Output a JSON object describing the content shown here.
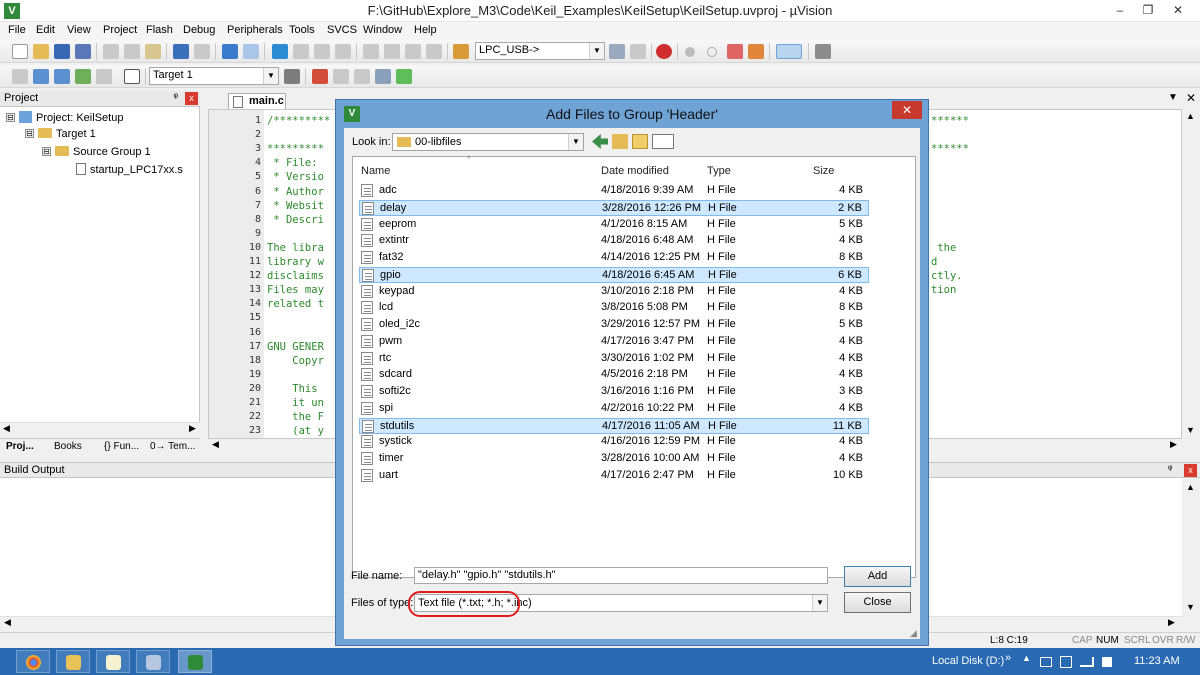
{
  "window": {
    "title": "F:\\GitHub\\Explore_M3\\Code\\Keil_Examples\\KeilSetup\\KeilSetup.uvproj - µVision",
    "minimize": "–",
    "maximize": "❐",
    "close": "✕"
  },
  "menu": [
    "File",
    "Edit",
    "View",
    "Project",
    "Flash",
    "Debug",
    "Peripherals",
    "Tools",
    "SVCS",
    "Window",
    "Help"
  ],
  "toolbar": {
    "target_combo": "LPC_USB->",
    "build_target": "Target 1"
  },
  "project_panel": {
    "title": "Project",
    "pin": "ᵠ",
    "close": "x",
    "tree": [
      {
        "label": "Project: KeilSetup",
        "level": 0,
        "expander": "⊟"
      },
      {
        "label": "Target 1",
        "level": 1,
        "expander": "⊟"
      },
      {
        "label": "Source Group 1",
        "level": 2,
        "expander": "⊟"
      },
      {
        "label": "startup_LPC17xx.s",
        "level": 3,
        "expander": ""
      }
    ],
    "tabs": [
      "Proj...",
      "Books",
      "{} Fun...",
      "0→ Tem..."
    ]
  },
  "editor": {
    "tab": "main.c",
    "line_numbers": [
      "1",
      "2",
      "3",
      "4",
      "5",
      "6",
      "7",
      "8",
      "9",
      "10",
      "11",
      "12",
      "13",
      "14",
      "15",
      "16",
      "17",
      "18",
      "19",
      "20",
      "21",
      "22",
      "23"
    ],
    "code_left": [
      "/*********",
      "",
      "*********",
      " * File:",
      " * Versio",
      " * Author",
      " * Websit",
      " * Descri",
      "",
      "The libra",
      "library w",
      "disclaims",
      "Files may",
      "related t",
      "",
      "",
      "GNU GENER",
      "    Copyr",
      "",
      "    This",
      "    it un",
      "    the F",
      "    (at y"
    ],
    "code_right": [
      {
        "line": 1,
        "text": "******"
      },
      {
        "line": 3,
        "text": "******"
      },
      {
        "line": 10,
        "text": " the"
      },
      {
        "line": 11,
        "text": "d"
      },
      {
        "line": 12,
        "text": "ctly."
      },
      {
        "line": 13,
        "text": "tion"
      }
    ]
  },
  "build_output": {
    "title": "Build Output"
  },
  "status_bar": {
    "position": "L:8 C:19",
    "caps": "CAP",
    "num": "NUM",
    "scrl": "SCRL",
    "ovr": "OVR",
    "rw": "R/W"
  },
  "taskbar": {
    "location": "Local Disk (D:)",
    "chevron": "»",
    "time": "11:23 AM"
  },
  "dialog": {
    "title": "Add Files to Group 'Header'",
    "close": "✕",
    "look_in_label": "Look in:",
    "look_in_value": "00-libfiles",
    "columns": {
      "name": "Name",
      "date": "Date modified",
      "type": "Type",
      "size": "Size"
    },
    "files": [
      {
        "name": "adc",
        "date": "4/18/2016 9:39 AM",
        "type": "H File",
        "size": "4 KB",
        "selected": false
      },
      {
        "name": "delay",
        "date": "3/28/2016 12:26 PM",
        "type": "H File",
        "size": "2 KB",
        "selected": true
      },
      {
        "name": "eeprom",
        "date": "4/1/2016 8:15 AM",
        "type": "H File",
        "size": "5 KB",
        "selected": false
      },
      {
        "name": "extintr",
        "date": "4/18/2016 6:48 AM",
        "type": "H File",
        "size": "4 KB",
        "selected": false
      },
      {
        "name": "fat32",
        "date": "4/14/2016 12:25 PM",
        "type": "H File",
        "size": "8 KB",
        "selected": false
      },
      {
        "name": "gpio",
        "date": "4/18/2016 6:45 AM",
        "type": "H File",
        "size": "6 KB",
        "selected": true
      },
      {
        "name": "keypad",
        "date": "3/10/2016 2:18 PM",
        "type": "H File",
        "size": "4 KB",
        "selected": false
      },
      {
        "name": "lcd",
        "date": "3/8/2016 5:08 PM",
        "type": "H File",
        "size": "8 KB",
        "selected": false
      },
      {
        "name": "oled_i2c",
        "date": "3/29/2016 12:57 PM",
        "type": "H File",
        "size": "5 KB",
        "selected": false
      },
      {
        "name": "pwm",
        "date": "4/17/2016 3:47 PM",
        "type": "H File",
        "size": "4 KB",
        "selected": false
      },
      {
        "name": "rtc",
        "date": "3/30/2016 1:02 PM",
        "type": "H File",
        "size": "4 KB",
        "selected": false
      },
      {
        "name": "sdcard",
        "date": "4/5/2016 2:18 PM",
        "type": "H File",
        "size": "4 KB",
        "selected": false
      },
      {
        "name": "softi2c",
        "date": "3/16/2016 1:16 PM",
        "type": "H File",
        "size": "3 KB",
        "selected": false
      },
      {
        "name": "spi",
        "date": "4/2/2016 10:22 PM",
        "type": "H File",
        "size": "4 KB",
        "selected": false
      },
      {
        "name": "stdutils",
        "date": "4/17/2016 11:05 AM",
        "type": "H File",
        "size": "11 KB",
        "selected": true
      },
      {
        "name": "systick",
        "date": "4/16/2016 12:59 PM",
        "type": "H File",
        "size": "4 KB",
        "selected": false
      },
      {
        "name": "timer",
        "date": "3/28/2016 10:00 AM",
        "type": "H File",
        "size": "4 KB",
        "selected": false
      },
      {
        "name": "uart",
        "date": "4/17/2016 2:47 PM",
        "type": "H File",
        "size": "10 KB",
        "selected": false
      }
    ],
    "file_name_label": "File name:",
    "file_name_value": "\"delay.h\" \"gpio.h\" \"stdutils.h\"",
    "file_type_label": "Files of type:",
    "file_type_value": "Text file (*.txt; *.h; *.inc)",
    "add_button": "Add",
    "close_button": "Close"
  },
  "colors": {
    "dialog_frame": "#6fa3d6",
    "selection": "#cde8ff",
    "highlight_ring": "#e01d1d",
    "comment_green": "#2d8a2d",
    "taskbar": "#2a6ab3"
  }
}
